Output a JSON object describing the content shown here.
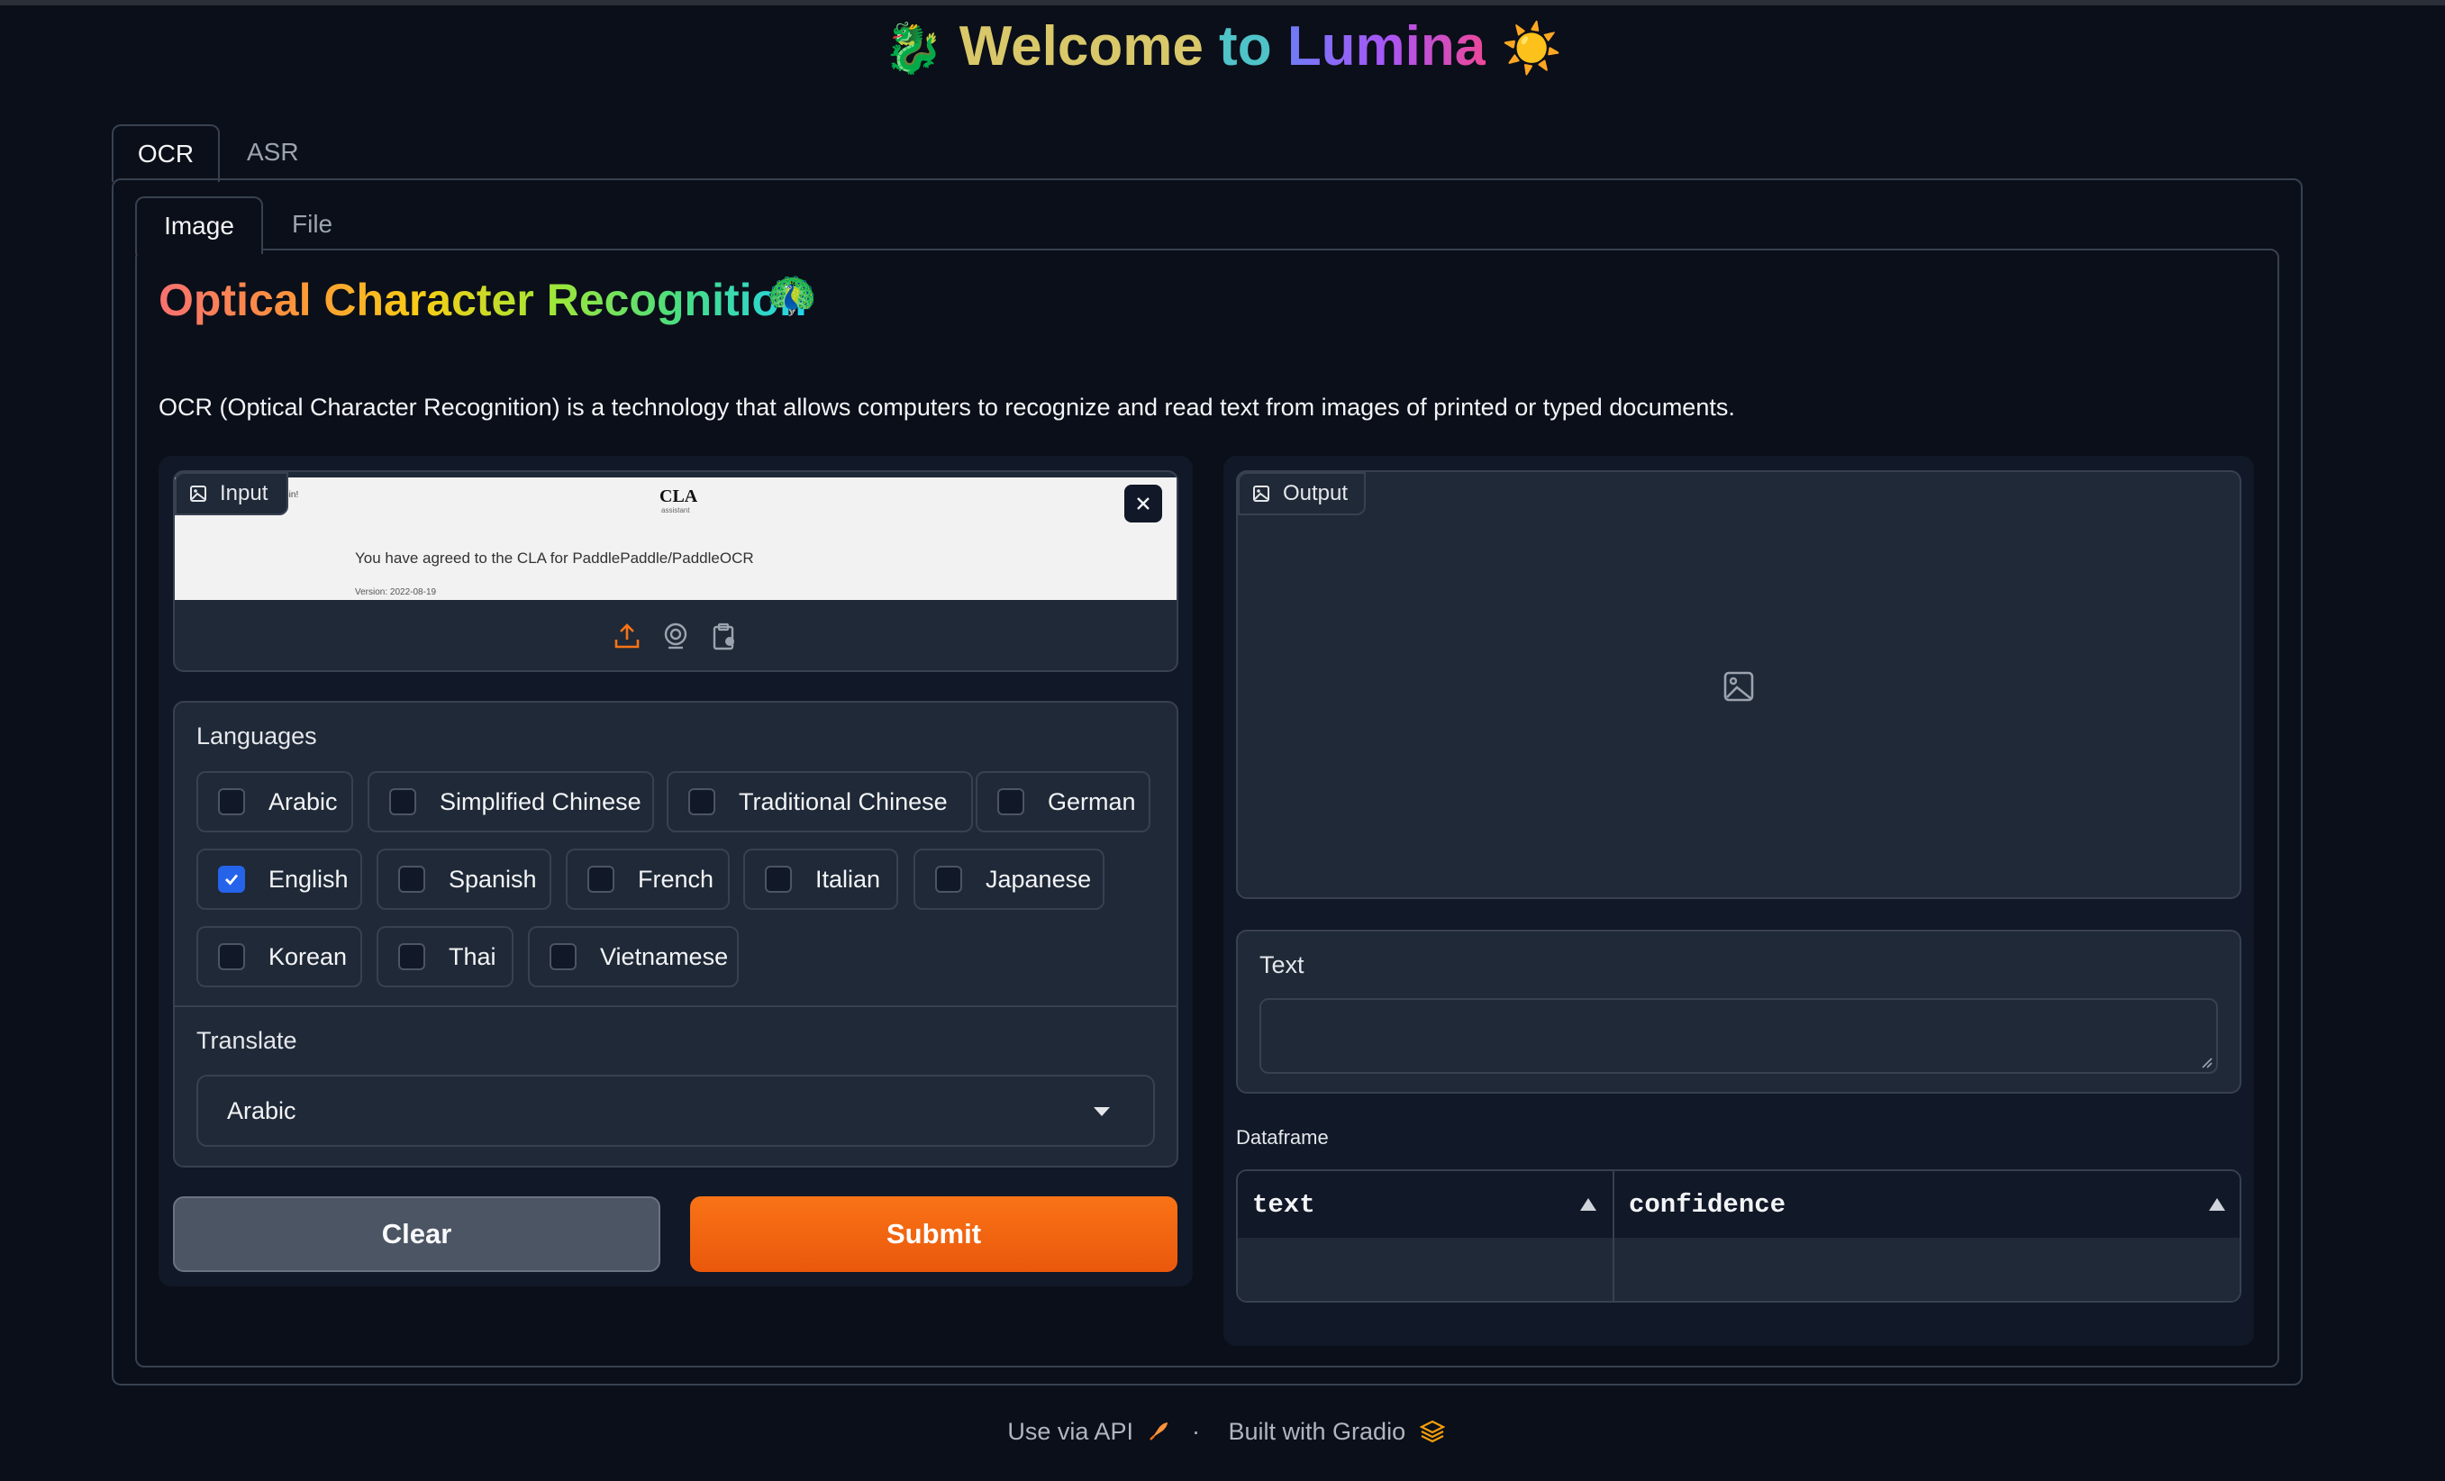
{
  "header": {
    "prefix_emoji": "🐉",
    "word1": "Welcome",
    "word2": "to",
    "word3": "Lumina",
    "suffix_emoji": "☀️"
  },
  "top_tabs": [
    {
      "label": "OCR",
      "active": true
    },
    {
      "label": "ASR",
      "active": false
    }
  ],
  "sub_tabs": [
    {
      "label": "Image",
      "active": true
    },
    {
      "label": "File",
      "active": false
    }
  ],
  "section": {
    "title": "Optical Character Recognition",
    "title_emoji": "🦚",
    "description": "OCR (Optical Character Recognition) is a technology that allows computers to recognize and read text from images of printed or typed documents."
  },
  "input": {
    "label": "Input",
    "preview": {
      "corner_text": "Sin!",
      "heading": "CLA",
      "subheading": "assistant",
      "message": "You have agreed to the CLA for PaddlePaddle/PaddleOCR",
      "version": "Version: 2022-08-19"
    },
    "source_icons": [
      "upload-icon",
      "webcam-icon",
      "clipboard-icon"
    ]
  },
  "languages": {
    "label": "Languages",
    "options": [
      {
        "label": "Arabic",
        "checked": false
      },
      {
        "label": "Simplified Chinese",
        "checked": false
      },
      {
        "label": "Traditional Chinese",
        "checked": false
      },
      {
        "label": "German",
        "checked": false
      },
      {
        "label": "English",
        "checked": true
      },
      {
        "label": "Spanish",
        "checked": false
      },
      {
        "label": "French",
        "checked": false
      },
      {
        "label": "Italian",
        "checked": false
      },
      {
        "label": "Japanese",
        "checked": false
      },
      {
        "label": "Korean",
        "checked": false
      },
      {
        "label": "Thai",
        "checked": false
      },
      {
        "label": "Vietnamese",
        "checked": false
      }
    ]
  },
  "translate": {
    "label": "Translate",
    "selected": "Arabic"
  },
  "buttons": {
    "clear": "Clear",
    "submit": "Submit"
  },
  "output": {
    "label": "Output",
    "text_label": "Text",
    "text_value": "",
    "dataframe_label": "Dataframe",
    "columns": [
      "text",
      "confidence"
    ]
  },
  "footer": {
    "api_text": "Use via API",
    "separator": "·",
    "built_text": "Built with Gradio"
  },
  "colors": {
    "background": "#0b0f19",
    "panel": "#111827",
    "block": "#1f2937",
    "border": "#374151",
    "accent_orange": "#ea580c",
    "checkbox_blue": "#2563eb"
  }
}
